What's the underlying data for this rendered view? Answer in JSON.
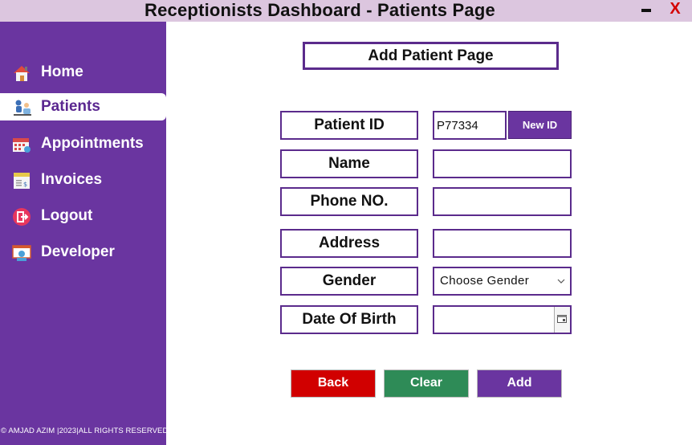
{
  "window": {
    "title": "Receptionists Dashboard - Patients Page",
    "minimize_label": "▬",
    "close_label": "X"
  },
  "sidebar": {
    "items": [
      {
        "label": "Home",
        "icon": "home-icon",
        "active": false
      },
      {
        "label": "Patients",
        "icon": "patients-icon",
        "active": true
      },
      {
        "label": "Appointments",
        "icon": "calendar-icon",
        "active": false
      },
      {
        "label": "Invoices",
        "icon": "invoice-icon",
        "active": false
      },
      {
        "label": "Logout",
        "icon": "logout-icon",
        "active": false
      },
      {
        "label": "Developer",
        "icon": "developer-icon",
        "active": false
      }
    ],
    "footer": "© AMJAD AZIM |2023|ALL RIGHTS RESERVED"
  },
  "main": {
    "heading": "Add Patient Page",
    "fields": {
      "patient_id": {
        "label": "Patient ID",
        "value": "P77334"
      },
      "name": {
        "label": "Name",
        "value": ""
      },
      "phone": {
        "label": "Phone NO.",
        "value": ""
      },
      "address": {
        "label": "Address",
        "value": ""
      },
      "gender": {
        "label": "Gender",
        "selected": "Choose Gender"
      },
      "dob": {
        "label": "Date Of Birth",
        "value": ""
      }
    },
    "new_id_label": "New ID",
    "buttons": {
      "back": "Back",
      "clear": "Clear",
      "add": "Add"
    }
  },
  "colors": {
    "sidebar": "#6a35a0",
    "titlebar": "#dcc6df",
    "back": "#d10000",
    "clear": "#2e8b57",
    "add": "#6a35a0"
  }
}
